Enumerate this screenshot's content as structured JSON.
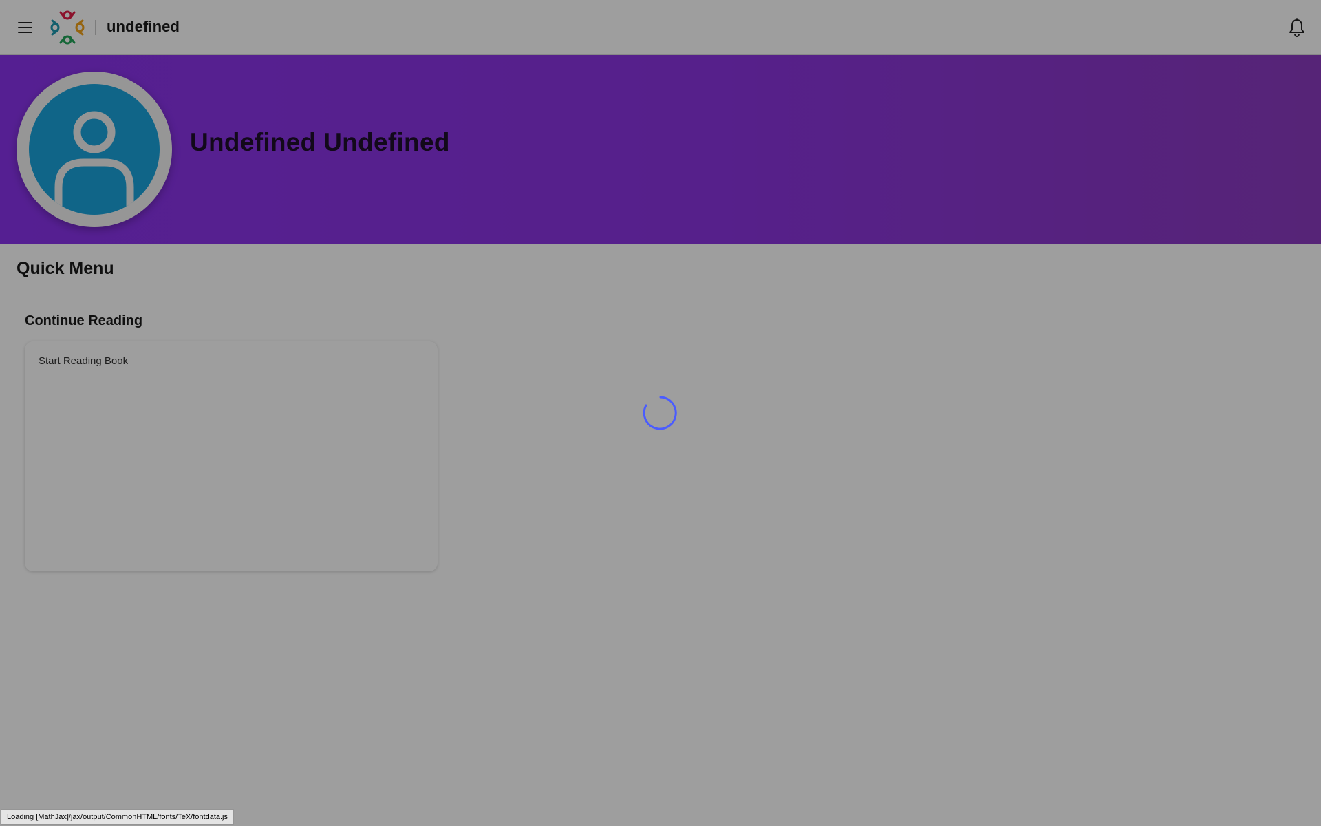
{
  "header": {
    "app_name": "undefined",
    "menu_icon": "hamburger-menu-icon",
    "notification_icon": "bell-icon"
  },
  "profile": {
    "name": "Undefined Undefined",
    "avatar_icon": "user-avatar-icon"
  },
  "main": {
    "quick_menu_title": "Quick Menu",
    "continue_reading_title": "Continue Reading",
    "reading_card_text": "Start Reading Book"
  },
  "status": {
    "loading_message": "Loading [MathJax]/jax/output/CommonHTML/fonts/TeX/fontdata.js"
  },
  "colors": {
    "banner": "#8a33ec",
    "avatar_background": "#1aa4dc",
    "spinner": "#4a5cff"
  }
}
